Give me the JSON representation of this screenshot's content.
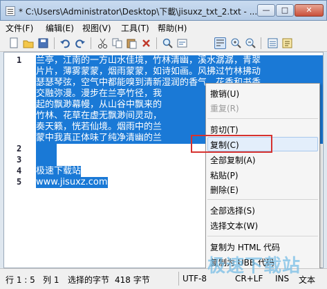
{
  "window": {
    "title": "* C:\\Users\\Administrator\\Desktop\\下載\\jisuxz_txt_2.txt - ...",
    "min_symbol": "—",
    "max_symbol": "□",
    "close_symbol": "✕"
  },
  "menu": [
    "文件(F)",
    "编辑(E)",
    "视图(V)",
    "工具(T)",
    "帮助(H)"
  ],
  "toolbar_icons": [
    "new-file-icon",
    "open-folder-icon",
    "save-icon",
    "undo-icon",
    "redo-icon",
    "cut-icon",
    "copy-icon",
    "paste-icon",
    "delete-icon",
    "find-icon",
    "word-wrap-icon",
    "zoom-in-icon",
    "zoom-out-icon",
    "properties-icon",
    "settings-icon"
  ],
  "editor": {
    "line_numbers": [
      "1",
      "2",
      "3",
      "4",
      "5"
    ],
    "lines": [
      "兰亭，江南的一方山水佳境，竹林清幽，溪水潺潺，青翠",
      "片片，薄雾蒙蒙，烟雨蒙蒙，如诗如画。风拂过竹林拂动",
      "瑟瑟琴弦，空气中都能嗅到清新湿润的香气，花香和书香",
      "交融弥漫。漫步在兰亭竹径，我",
      "起的飘渺幕幔，从山谷中飘来的",
      "竹林、花草在虚无飘渺间灵动，",
      "奏天籁，恍若仙境。烟雨中的兰",
      "蒙中我真正体味了纯净清幽的兰"
    ],
    "line4": "极速下载站",
    "line5": "www.jisuxz.com"
  },
  "context_menu": {
    "items": [
      {
        "label": "撤销(U)",
        "enabled": true
      },
      {
        "label": "重复(R)",
        "enabled": false
      },
      {
        "label": "剪切(T)",
        "enabled": true
      },
      {
        "label": "复制(C)",
        "enabled": true
      },
      {
        "label": "全部复制(A)",
        "enabled": true
      },
      {
        "label": "粘贴(P)",
        "enabled": true
      },
      {
        "label": "删除(E)",
        "enabled": true
      },
      {
        "label": "全部选择(S)",
        "enabled": true
      },
      {
        "label": "选择文本(W)",
        "enabled": true
      },
      {
        "label": "复制为 HTML 代码",
        "enabled": true
      },
      {
        "label": "复制为 UBB 代码",
        "enabled": true
      }
    ],
    "highlighted": "复制(C)"
  },
  "status": {
    "position": "行 1 : 5",
    "column": "列 1",
    "selected_label": "选择的字节",
    "bytes": "418 字节",
    "encoding": "UTF-8",
    "eol": "CR+LF",
    "mode": "INS",
    "doc_type": "文本"
  },
  "watermark": "极速下载站",
  "colors": {
    "selection": "#1a79d6",
    "highlight_box": "#d6312e"
  }
}
